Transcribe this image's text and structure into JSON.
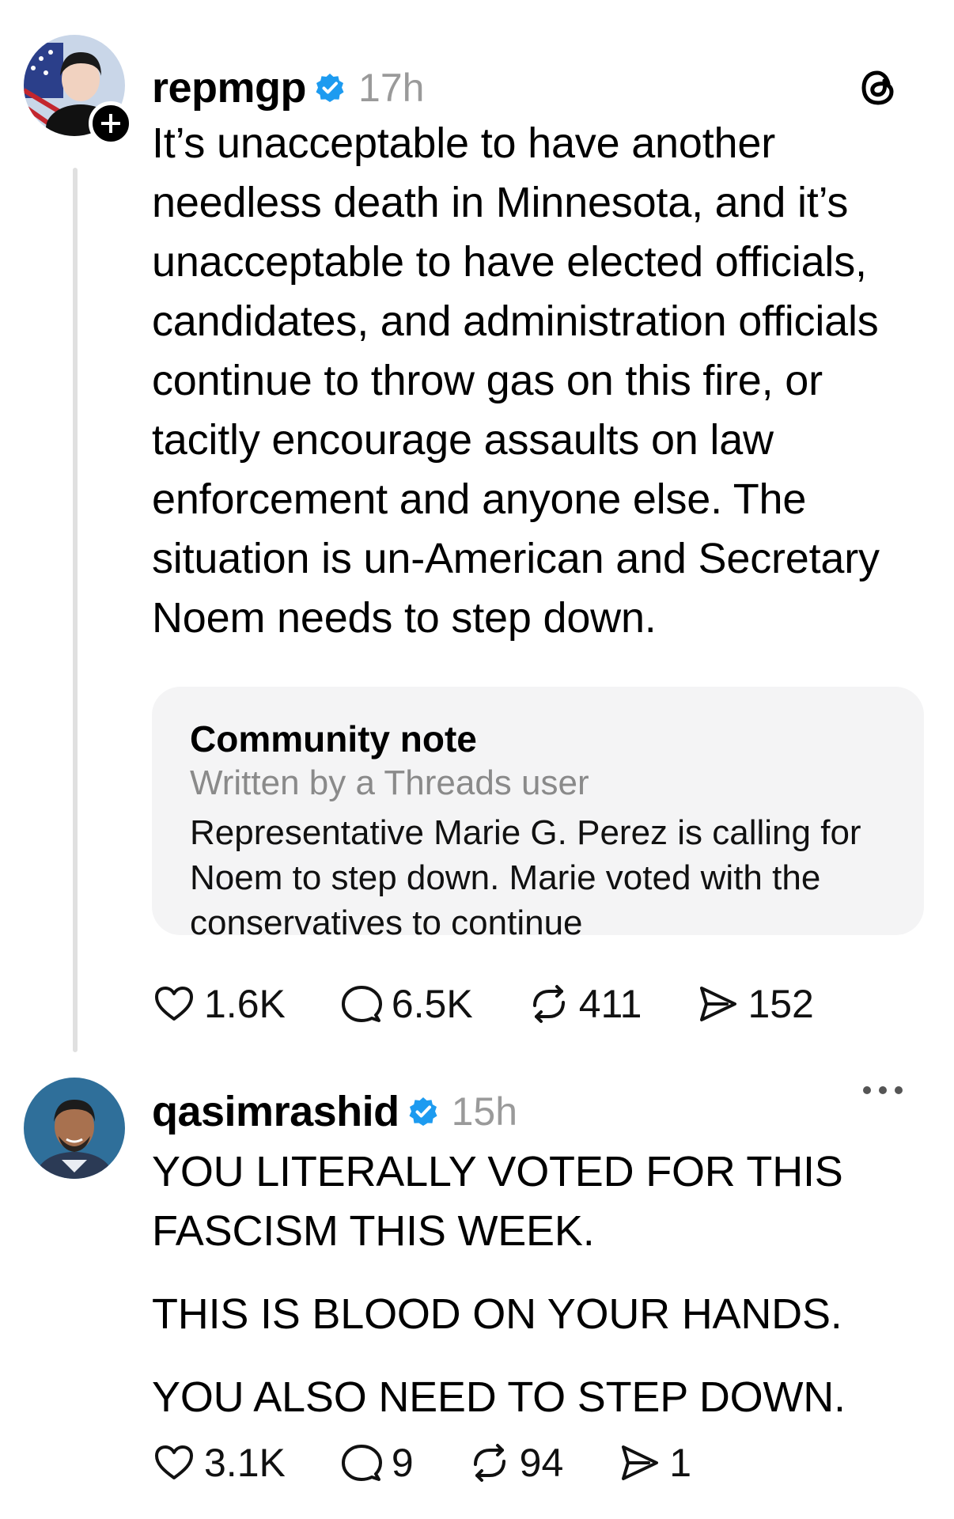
{
  "post1": {
    "username": "repmgp",
    "time": "17h",
    "body": "It’s unacceptable to have another needless death in Minnesota, and it’s unacceptable to have elected officials, candidates, and administration officials continue to throw gas on this fire, or tacitly encourage assaults on law enforcement and anyone else. The situation is un-American and Secretary Noem needs to step down.",
    "community_note": {
      "title": "Community note",
      "subtitle": "Written by a Threads user",
      "text": "Representative Marie G. Perez is calling for Noem to step down. Marie voted with the conservatives to continue"
    },
    "actions": {
      "likes": "1.6K",
      "replies": "6.5K",
      "reposts": "411",
      "shares": "152"
    }
  },
  "post2": {
    "username": "qasimrashid",
    "time": "15h",
    "paragraphs": [
      "YOU LITERALLY VOTED FOR THIS FASCISM THIS WEEK.",
      "THIS IS BLOOD ON YOUR HANDS.",
      "YOU ALSO NEED TO STEP DOWN."
    ],
    "actions": {
      "likes": "3.1K",
      "replies": "9",
      "reposts": "94",
      "shares": "1"
    }
  },
  "colors": {
    "verified": "#1d9bf0",
    "muted": "#9a9a9a",
    "note_bg": "#f4f4f5"
  }
}
